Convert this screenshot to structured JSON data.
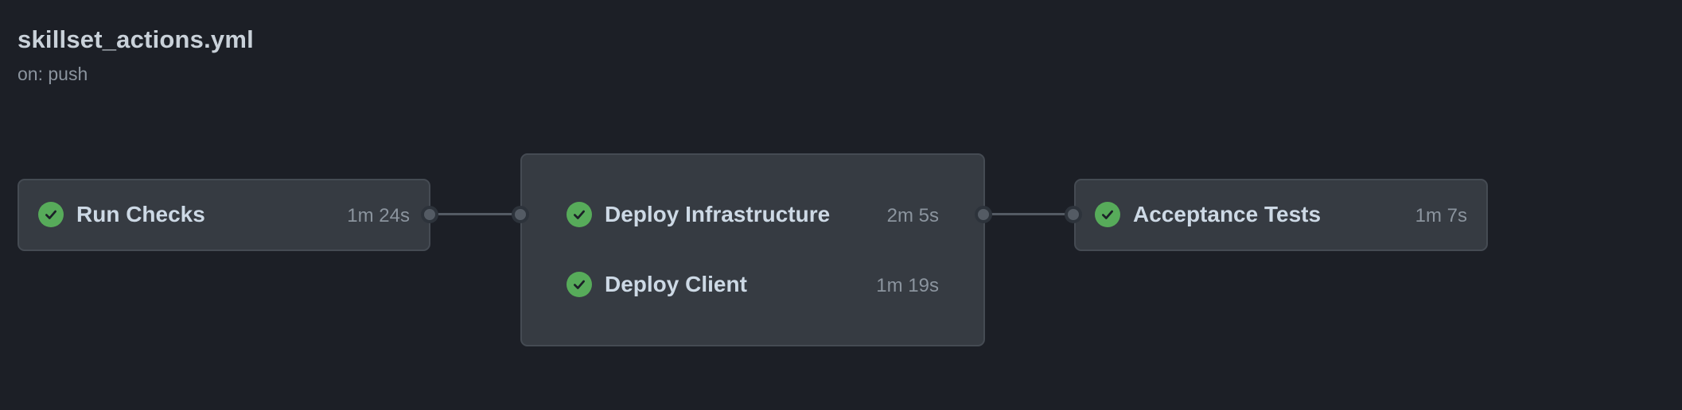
{
  "workflow": {
    "title": "skillset_actions.yml",
    "trigger": "on: push"
  },
  "jobs": {
    "run_checks": {
      "name": "Run Checks",
      "duration": "1m 24s",
      "status": "success"
    },
    "deploy_infrastructure": {
      "name": "Deploy Infrastructure",
      "duration": "2m 5s",
      "status": "success"
    },
    "deploy_client": {
      "name": "Deploy Client",
      "duration": "1m 19s",
      "status": "success"
    },
    "acceptance_tests": {
      "name": "Acceptance Tests",
      "duration": "1m 7s",
      "status": "success"
    }
  },
  "colors": {
    "background": "#1c1f26",
    "job_box": "#363b42",
    "success": "#57ab5a",
    "connector": "#545b64",
    "text_primary": "#cdd9e5",
    "text_secondary": "#8b949e"
  },
  "icons": {
    "status_success": "check-circle-icon"
  }
}
